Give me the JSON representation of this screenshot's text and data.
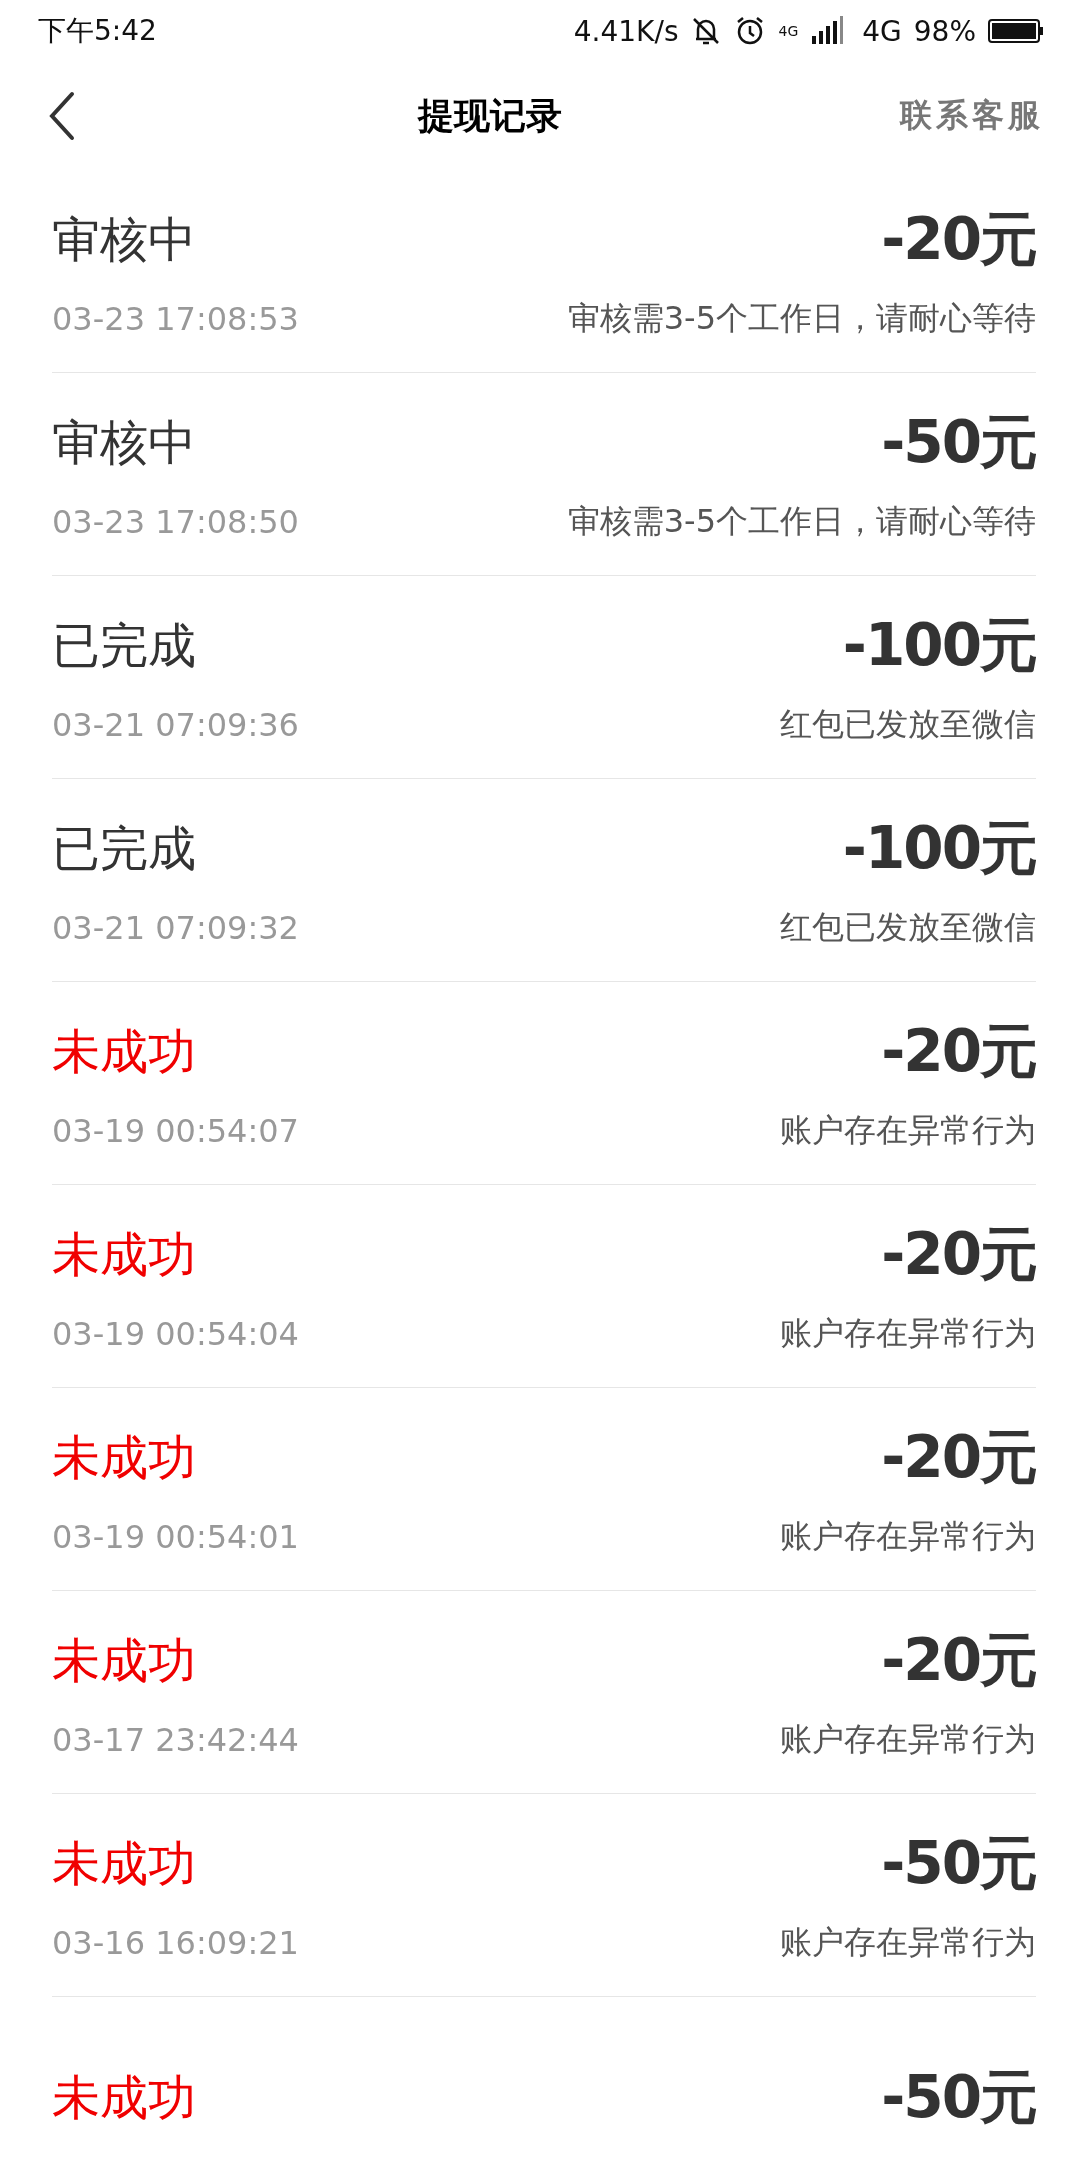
{
  "status_bar": {
    "time": "下午5:42",
    "speed": "4.41K/s",
    "network_small": "4G",
    "network": "4G",
    "battery": "98%"
  },
  "header": {
    "title": "提现记录",
    "action": "联系客服"
  },
  "records": [
    {
      "status": "审核中",
      "kind": "pending",
      "amount": "-20元",
      "time": "03-23 17:08:53",
      "note": "审核需3-5个工作日，请耐心等待"
    },
    {
      "status": "审核中",
      "kind": "pending",
      "amount": "-50元",
      "time": "03-23 17:08:50",
      "note": "审核需3-5个工作日，请耐心等待"
    },
    {
      "status": "已完成",
      "kind": "done",
      "amount": "-100元",
      "time": "03-21 07:09:36",
      "note": "红包已发放至微信"
    },
    {
      "status": "已完成",
      "kind": "done",
      "amount": "-100元",
      "time": "03-21 07:09:32",
      "note": "红包已发放至微信"
    },
    {
      "status": "未成功",
      "kind": "failed",
      "amount": "-20元",
      "time": "03-19 00:54:07",
      "note": "账户存在异常行为"
    },
    {
      "status": "未成功",
      "kind": "failed",
      "amount": "-20元",
      "time": "03-19 00:54:04",
      "note": "账户存在异常行为"
    },
    {
      "status": "未成功",
      "kind": "failed",
      "amount": "-20元",
      "time": "03-19 00:54:01",
      "note": "账户存在异常行为"
    },
    {
      "status": "未成功",
      "kind": "failed",
      "amount": "-20元",
      "time": "03-17 23:42:44",
      "note": "账户存在异常行为"
    },
    {
      "status": "未成功",
      "kind": "failed",
      "amount": "-50元",
      "time": "03-16 16:09:21",
      "note": "账户存在异常行为"
    },
    {
      "status": "未成功",
      "kind": "failed",
      "amount": "-50元"
    }
  ]
}
